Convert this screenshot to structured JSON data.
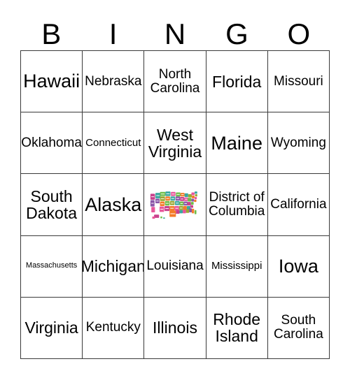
{
  "header": {
    "letters": [
      "B",
      "I",
      "N",
      "G",
      "O"
    ]
  },
  "grid": {
    "rows": [
      [
        {
          "label": "Hawaii",
          "size": "xl"
        },
        {
          "label": "Nebraska",
          "size": "md"
        },
        {
          "label": "North\nCarolina",
          "size": "md"
        },
        {
          "label": "Florida",
          "size": "lg"
        },
        {
          "label": "Missouri",
          "size": "md"
        }
      ],
      [
        {
          "label": "Oklahoma",
          "size": "md"
        },
        {
          "label": "Connecticut",
          "size": "sm"
        },
        {
          "label": "West\nVirginia",
          "size": "lg"
        },
        {
          "label": "Maine",
          "size": "xl"
        },
        {
          "label": "Wyoming",
          "size": "md"
        }
      ],
      [
        {
          "label": "South\nDakota",
          "size": "lg"
        },
        {
          "label": "Alaska",
          "size": "xl"
        },
        {
          "label": "",
          "size": "md",
          "free": true,
          "icon": "us-map-image"
        },
        {
          "label": "District of\nColumbia",
          "size": "md"
        },
        {
          "label": "California",
          "size": "md"
        }
      ],
      [
        {
          "label": "Massachusetts",
          "size": "xs"
        },
        {
          "label": "Michigan",
          "size": "lg"
        },
        {
          "label": "Louisiana",
          "size": "md"
        },
        {
          "label": "Mississippi",
          "size": "sm"
        },
        {
          "label": "Iowa",
          "size": "xl"
        }
      ],
      [
        {
          "label": "Virginia",
          "size": "lg"
        },
        {
          "label": "Kentucky",
          "size": "md"
        },
        {
          "label": "Illinois",
          "size": "lg"
        },
        {
          "label": "Rhode\nIsland",
          "size": "lg"
        },
        {
          "label": "South\nCarolina",
          "size": "md"
        }
      ]
    ]
  },
  "colors": {
    "border": "#3a3a3a",
    "text": "#000000",
    "background": "#ffffff",
    "map_teal": "#3aa8a0",
    "map_green": "#6fbe4a",
    "map_orange": "#f47b28",
    "map_pink": "#e8569a",
    "map_purple": "#8a55a8",
    "map_magenta": "#c8418c",
    "map_olive": "#9aa832",
    "map_blue": "#4a9fd8"
  }
}
